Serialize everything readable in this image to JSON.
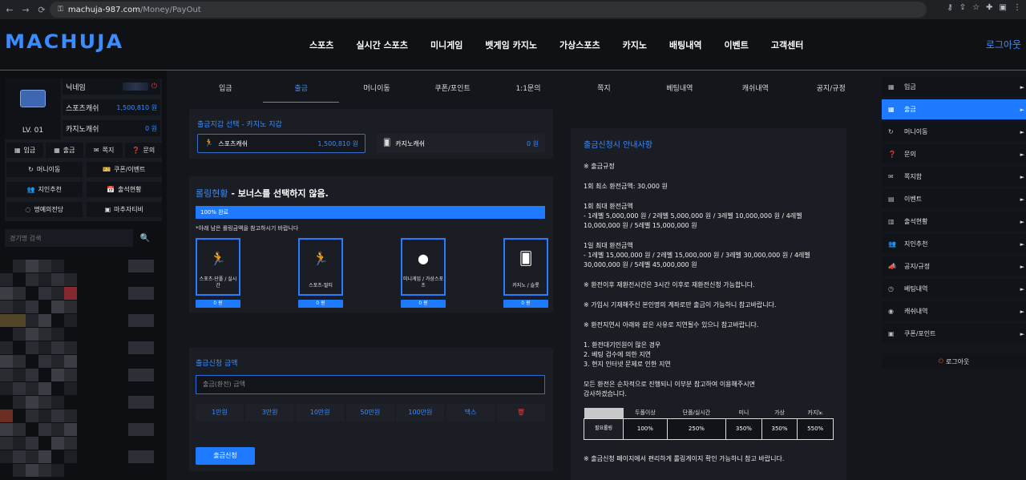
{
  "browser": {
    "url_host": "machuja-987.com",
    "url_path": "/Money/PayOut",
    "back": "←",
    "forward": "→",
    "reload": "⟳",
    "lock": "⚿",
    "right_icons": [
      "⚷",
      "⇪",
      "☆",
      "✚",
      "▣",
      "⋮"
    ]
  },
  "header": {
    "logo": "MACHUJA",
    "nav": [
      "스포츠",
      "실시간 스포츠",
      "미니게임",
      "벳게임 카지노",
      "가상스포츠",
      "카지노",
      "배팅내역",
      "이벤트",
      "고객센터"
    ],
    "logout": "로그아웃"
  },
  "user": {
    "level": "LV. 01",
    "rows": [
      {
        "key": "닉네임",
        "value": ""
      },
      {
        "key": "스포츠캐쉬",
        "value": "1,500,810 원"
      },
      {
        "key": "카지노캐쉬",
        "value": "0 원"
      }
    ],
    "quick_top": [
      {
        "icon": "▦",
        "label": "입금"
      },
      {
        "icon": "▦",
        "label": "출금"
      },
      {
        "icon": "✉",
        "label": "쪽지"
      },
      {
        "icon": "❓",
        "label": "문의"
      }
    ],
    "quick_bottom": [
      {
        "icon": "↻",
        "label": "머니이동"
      },
      {
        "icon": "🎫",
        "label": "쿠폰/이벤트"
      },
      {
        "icon": "👥",
        "label": "지인추천"
      },
      {
        "icon": "📅",
        "label": "출석현황"
      },
      {
        "icon": "◌",
        "label": "명예의전당"
      },
      {
        "icon": "▣",
        "label": "마추자티비"
      }
    ],
    "power_icon": "⏻"
  },
  "search": {
    "placeholder": "경기명 검색",
    "icon": "🔍"
  },
  "tabs": [
    "입금",
    "출금",
    "머니이동",
    "쿠폰/포인트",
    "1:1문의",
    "쪽지",
    "베팅내역",
    "캐쉬내역",
    "공지/규정"
  ],
  "active_tab": 1,
  "wallet": {
    "title": "출금지갑 선택 - 카지노 지갑",
    "sports": {
      "icon": "🏃",
      "label": "스포츠캐쉬",
      "amount": "1,500,810 원"
    },
    "casino": {
      "icon": "🂠",
      "label": "카지노캐쉬",
      "amount": "0 원"
    }
  },
  "rolling": {
    "title_blue": "롤링현황",
    "title_rest": " - 보너스를 선택하지 않음.",
    "bar_label": "100% 완료",
    "progress": 1.0,
    "note": "*아래 남은 롤링금액을 참고하시기 바랍니다",
    "games": [
      {
        "icon": "🏃",
        "label": "스포츠-단폴 / 실시간",
        "value": "0 원"
      },
      {
        "icon": "🏃",
        "label": "스포츠-멀티",
        "value": "0 원"
      },
      {
        "icon": "●",
        "label": "미니게임 / 가상스포츠",
        "value": "0 원"
      },
      {
        "icon": "🂠",
        "label": "카지노 / 슬롯",
        "value": "0 원"
      }
    ]
  },
  "withdraw": {
    "title": "출금신청 금액",
    "placeholder": "출금(환전) 금액",
    "amounts": [
      "1만원",
      "3만원",
      "10만원",
      "50만원",
      "100만원",
      "맥스"
    ],
    "trash_icon": "🗑",
    "submit": "출금신청"
  },
  "guide": {
    "title": "출금신청시 안내사항",
    "paragraphs": [
      "※ 출금규정",
      "1회 최소 환전금액: 30,000 원",
      "1회 최대 환전금액\n- 1레벨 5,000,000 원 / 2레벨 5,000,000 원 / 3레벨 10,000,000 원 / 4레벨 10,000,000 원 / 5레벨 15,000,000 원",
      "1일 최대 환전금액\n- 1레벨 15,000,000 원 / 2레벨 15,000,000 원 / 3레벨 30,000,000 원 / 4레벨 30,000,000 원 / 5레벨 45,000,000 원",
      "※ 환전이후 재환전시간은 3시간 이후로 재환전신청 가능합니다.",
      "※ 가입시 기재해주신 본인명의 계좌로만 출금이 가능하니 참고바랍니다.",
      "※ 환전지연시 아래와 같은 사유로 지연될수 있으니 참고바랍니다.",
      "1. 환전대기인원이 많은 경우\n2. 베팅 검수에 의한 지연\n3. 현지 인터넷 문제로 인한 지연",
      "모든 환전은 순차적으로 진행되니 이부분 참고하여 이용해주시면\n감사하겠습니다."
    ],
    "table_headers": [
      "두폴이상",
      "단폴/실시간",
      "미니",
      "가상",
      "카지노"
    ],
    "table_label": "필요롤링",
    "table_values": [
      "100%",
      "250%",
      "350%",
      "350%",
      "550%"
    ],
    "footer": "※ 출금신청 페이지에서 편리하게 롤링게이지 확인 가능하니 참고 바랍니다."
  },
  "right_menu": {
    "items": [
      {
        "icon": "▦",
        "label": "입금"
      },
      {
        "icon": "▦",
        "label": "출금"
      },
      {
        "icon": "↻",
        "label": "머니이동"
      },
      {
        "icon": "❓",
        "label": "문의"
      },
      {
        "icon": "✉",
        "label": "쪽지함"
      },
      {
        "icon": "▤",
        "label": "이벤트"
      },
      {
        "icon": "▥",
        "label": "출석현황"
      },
      {
        "icon": "👥",
        "label": "지인추천"
      },
      {
        "icon": "📣",
        "label": "공지/규정"
      },
      {
        "icon": "◷",
        "label": "베팅내역"
      },
      {
        "icon": "◉",
        "label": "캐쉬내역"
      },
      {
        "icon": "▣",
        "label": "쿠폰/포인트"
      }
    ],
    "active": 1,
    "arrow": "►",
    "logout_icon": "⏻",
    "logout": "로그아웃"
  }
}
